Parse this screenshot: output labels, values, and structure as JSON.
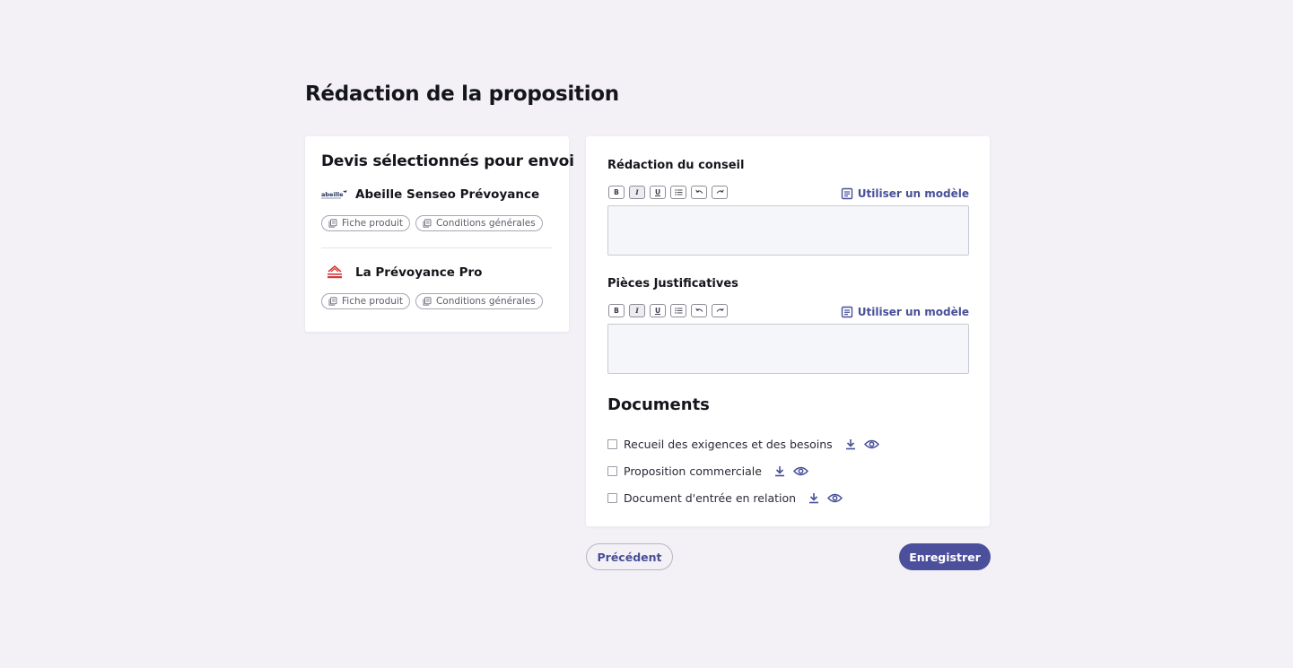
{
  "page": {
    "title": "Rédaction de la proposition"
  },
  "quotes": {
    "title": "Devis sélectionnés pour envoi",
    "products": [
      {
        "name": "Abeille Senseo Prévoyance",
        "logo": "abeille-logo",
        "logo_text": "abeille",
        "links": [
          "Fiche produit",
          "Conditions générales"
        ]
      },
      {
        "name": "La Prévoyance Pro",
        "logo": "prevoyance-pro-logo",
        "links": [
          "Fiche produit",
          "Conditions générales"
        ]
      }
    ]
  },
  "editors": {
    "conseil": {
      "label": "Rédaction du conseil",
      "use_template": "Utiliser un modèle",
      "value": ""
    },
    "pieces": {
      "label": "Pièces Justificatives",
      "use_template": "Utiliser un modèle",
      "value": ""
    },
    "toolbar": [
      "B",
      "I",
      "U",
      "list",
      "undo",
      "redo"
    ]
  },
  "documents": {
    "title": "Documents",
    "items": [
      {
        "label": "Recueil des exigences et des besoins",
        "checked": false
      },
      {
        "label": "Proposition commerciale",
        "checked": false
      },
      {
        "label": "Document d'entrée en relation",
        "checked": false
      }
    ]
  },
  "actions": {
    "previous": "Précédent",
    "save": "Enregistrer"
  },
  "colors": {
    "accent": "#4c4f9c",
    "link": "#474f97",
    "background": "#f3f1f6"
  }
}
